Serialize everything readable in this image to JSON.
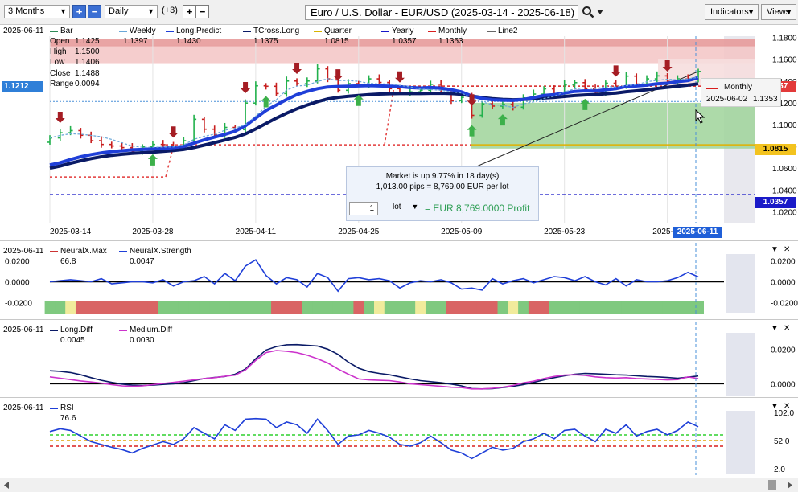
{
  "toolbar": {
    "period": "3 Months",
    "interval": "Daily",
    "overlay_count": "(+3)",
    "title": "Euro / U.S. Dollar - EUR/USD (2025-03-14 - 2025-06-18)",
    "indicators_label": "Indicators",
    "views_label": "Views",
    "plus_glyph": "+",
    "minus_glyph": "−",
    "arrow_glyph": "▼",
    "search_icon": "magnifier",
    "zoom_in_icon": "plus",
    "zoom_out_icon": "minus",
    "chevron_icon": "chevron-down"
  },
  "main_panel": {
    "date": "2025-06-11",
    "legend": [
      {
        "name": "Bar",
        "value": "",
        "color": "#2e8b57"
      },
      {
        "name": "Weekly",
        "value": "1.1397",
        "color": "#6aa7d8"
      },
      {
        "name": "Long.Predict",
        "value": "1.1430",
        "color": "#1f3fd8"
      },
      {
        "name": "TCross.Long",
        "value": "1.1375",
        "color": "#0a1a66"
      },
      {
        "name": "Quarter",
        "value": "1.0815",
        "color": "#d8b400"
      },
      {
        "name": "Yearly",
        "value": "1.0357",
        "color": "#1616c8"
      },
      {
        "name": "Monthly",
        "value": "1.1353",
        "color": "#d81e1e"
      },
      {
        "name": "Line2",
        "value": "",
        "color": "#666666"
      }
    ],
    "ohlc": {
      "open_label": "Open",
      "open": "1.1425",
      "high_label": "High",
      "high": "1.1500",
      "low_label": "Low",
      "low": "1.1406",
      "close_label": "Close",
      "close": "1.1488",
      "range_label": "Range",
      "range": "0.0094"
    },
    "cursor_price": "1.1212",
    "price_labels": {
      "monthly": "1.1357",
      "quarter": "1.0815",
      "yearly": "1.0357"
    },
    "y_ticks": [
      "1.1800",
      "1.1600",
      "1.1400",
      "1.1200",
      "1.1000",
      "1.0800",
      "1.0600",
      "1.0400",
      "1.0200"
    ],
    "x_ticks": [
      "2025-03-14",
      "2025-03-28",
      "2025-04-11",
      "2025-04-25",
      "2025-05-09",
      "2025-05-23",
      "2025-06"
    ],
    "cursor_date": "2025-06-11",
    "popup": {
      "line1": "Market is up 9.77% in 18 day(s)",
      "line2": "1,013.00 pips = 8,769.00 EUR per lot",
      "lot_value": "1",
      "lot_label": "lot",
      "lot_arrow": "▼",
      "profit": "= EUR 8,769.0000 Profit"
    },
    "tooltip": {
      "title": "Monthly",
      "date": "2025-06-02",
      "value": "1.1353",
      "color": "#d81e1e"
    }
  },
  "neural_panel": {
    "date": "2025-06-11",
    "legend": [
      {
        "name": "NeuralX.Max",
        "value": "66.8",
        "color": "#cc3333"
      },
      {
        "name": "NeuralX.Strength",
        "value": "0.0047",
        "color": "#1f3fd8"
      }
    ],
    "y_ticks": [
      "0.0200",
      "0.0000",
      "-0.0200"
    ],
    "close_glyph": "✕",
    "collapse_glyph": "▼"
  },
  "diff_panel": {
    "date": "2025-06-11",
    "legend": [
      {
        "name": "Long.Diff",
        "value": "0.0045",
        "color": "#0a1a66"
      },
      {
        "name": "Medium.Diff",
        "value": "0.0030",
        "color": "#cc33cc"
      }
    ],
    "y_ticks": [
      "0.0200",
      "0.0000"
    ],
    "close_glyph": "✕",
    "collapse_glyph": "▼"
  },
  "rsi_panel": {
    "date": "2025-06-11",
    "legend": [
      {
        "name": "RSI",
        "value": "76.6",
        "color": "#1f3fd8"
      }
    ],
    "y_ticks": [
      "102.0",
      "52.0",
      "2.0"
    ],
    "close_glyph": "✕",
    "collapse_glyph": "▼"
  },
  "chart_data": [
    {
      "type": "ohlc",
      "title": "",
      "x": [
        "2025-03-14",
        "2025-03-17",
        "2025-03-18",
        "2025-03-19",
        "2025-03-20",
        "2025-03-21",
        "2025-03-24",
        "2025-03-25",
        "2025-03-26",
        "2025-03-27",
        "2025-03-28",
        "2025-03-31",
        "2025-04-01",
        "2025-04-02",
        "2025-04-03",
        "2025-04-04",
        "2025-04-07",
        "2025-04-08",
        "2025-04-09",
        "2025-04-10",
        "2025-04-11",
        "2025-04-14",
        "2025-04-15",
        "2025-04-16",
        "2025-04-17",
        "2025-04-18",
        "2025-04-21",
        "2025-04-22",
        "2025-04-23",
        "2025-04-24",
        "2025-04-25",
        "2025-04-28",
        "2025-04-29",
        "2025-04-30",
        "2025-05-01",
        "2025-05-02",
        "2025-05-05",
        "2025-05-06",
        "2025-05-07",
        "2025-05-08",
        "2025-05-09",
        "2025-05-12",
        "2025-05-13",
        "2025-05-14",
        "2025-05-15",
        "2025-05-16",
        "2025-05-19",
        "2025-05-20",
        "2025-05-21",
        "2025-05-22",
        "2025-05-23",
        "2025-05-26",
        "2025-05-27",
        "2025-05-28",
        "2025-05-29",
        "2025-05-30",
        "2025-06-02",
        "2025-06-03",
        "2025-06-04",
        "2025-06-05",
        "2025-06-06",
        "2025-06-09",
        "2025-06-10",
        "2025-06-11"
      ],
      "close": [
        1.0878,
        1.0925,
        1.0945,
        1.0902,
        1.0852,
        1.0818,
        1.0804,
        1.0789,
        1.0754,
        1.0795,
        1.0818,
        1.0816,
        1.079,
        1.0852,
        1.1049,
        1.0958,
        1.0907,
        1.0974,
        1.0954,
        1.1198,
        1.1356,
        1.1352,
        1.1285,
        1.14,
        1.1375,
        1.14,
        1.1512,
        1.142,
        1.1315,
        1.1376,
        1.1365,
        1.142,
        1.1387,
        1.133,
        1.1295,
        1.13,
        1.1315,
        1.137,
        1.1295,
        1.122,
        1.125,
        1.1085,
        1.119,
        1.117,
        1.1185,
        1.116,
        1.1245,
        1.128,
        1.1328,
        1.1285,
        1.1365,
        1.1385,
        1.1327,
        1.1288,
        1.138,
        1.135,
        1.1445,
        1.1372,
        1.142,
        1.1447,
        1.1397,
        1.142,
        1.1418,
        1.1488
      ],
      "series": [
        {
          "name": "Weekly",
          "values": []
        },
        {
          "name": "Long.Predict",
          "values": [
            1.063,
            1.065,
            1.068,
            1.0705,
            1.0725,
            1.074,
            1.0752,
            1.076,
            1.0768,
            1.0772,
            1.0778,
            1.0782,
            1.079,
            1.08,
            1.083,
            1.086,
            1.0885,
            1.091,
            1.094,
            1.099,
            1.106,
            1.113,
            1.118,
            1.123,
            1.1275,
            1.1305,
            1.133,
            1.1345,
            1.135,
            1.1352,
            1.1355,
            1.1358,
            1.1355,
            1.1352,
            1.1348,
            1.134,
            1.1336,
            1.134,
            1.1335,
            1.132,
            1.13,
            1.1262,
            1.124,
            1.1228,
            1.1224,
            1.1222,
            1.123,
            1.1248,
            1.1268,
            1.1275,
            1.129,
            1.1305,
            1.131,
            1.1308,
            1.132,
            1.133,
            1.135,
            1.1355,
            1.1362,
            1.1375,
            1.138,
            1.1395,
            1.1405,
            1.143
          ]
        },
        {
          "name": "TCross.Long",
          "values": [
            1.06,
            1.062,
            1.0645,
            1.0668,
            1.0688,
            1.0705,
            1.0718,
            1.0728,
            1.0736,
            1.0742,
            1.0748,
            1.0755,
            1.0762,
            1.0772,
            1.079,
            1.0812,
            1.0835,
            1.0858,
            1.0882,
            1.0915,
            1.096,
            1.101,
            1.106,
            1.1105,
            1.1145,
            1.118,
            1.121,
            1.1235,
            1.125,
            1.126,
            1.1268,
            1.1275,
            1.128,
            1.1283,
            1.1285,
            1.1285,
            1.1285,
            1.1287,
            1.1288,
            1.1285,
            1.1278,
            1.1262,
            1.1248,
            1.1238,
            1.1232,
            1.1228,
            1.123,
            1.1236,
            1.1244,
            1.125,
            1.1258,
            1.1266,
            1.1272,
            1.1276,
            1.1283,
            1.129,
            1.1302,
            1.131,
            1.132,
            1.1332,
            1.1342,
            1.1352,
            1.1362,
            1.1375
          ]
        }
      ],
      "levels": [
        {
          "name": "Quarter",
          "value": 1.0815
        },
        {
          "name": "Yearly",
          "value": 1.0357
        },
        {
          "name": "Monthly",
          "value": 1.1353
        }
      ],
      "ylim": [
        1.01,
        1.19
      ],
      "x_ticks": [
        "2025-03-14",
        "2025-03-28",
        "2025-04-11",
        "2025-04-25",
        "2025-05-09",
        "2025-05-23",
        "2025-06-06"
      ],
      "down_signals": [
        "2025-03-17",
        "2025-04-01",
        "2025-04-10",
        "2025-04-17",
        "2025-04-23",
        "2025-05-01",
        "2025-05-12",
        "2025-05-30",
        "2025-06-06"
      ],
      "up_signals": [
        "2025-03-28",
        "2025-04-14",
        "2025-04-25",
        "2025-05-12",
        "2025-05-15",
        "2025-05-27"
      ],
      "profit_text": "Market is up 9.77% in 18 day(s)"
    },
    {
      "type": "line",
      "series": [
        {
          "name": "NeuralX.Strength",
          "values": [
            0.0,
            0.001,
            0.002,
            0.001,
            0.0,
            0.003,
            -0.002,
            -0.001,
            0.0,
            0.0,
            -0.001,
            0.002,
            -0.004,
            0.0,
            0.001,
            0.005,
            -0.002,
            0.008,
            0.001,
            0.015,
            0.021,
            0.006,
            -0.002,
            0.004,
            0.002,
            -0.005,
            0.008,
            0.004,
            -0.009,
            0.003,
            0.004,
            0.002,
            0.003,
            0.001,
            -0.006,
            -0.001,
            0.001,
            0.0,
            0.002,
            -0.001,
            -0.007,
            -0.006,
            -0.008,
            0.003,
            -0.002,
            0.001,
            0.003,
            -0.001,
            0.002,
            0.005,
            0.004,
            0.001,
            0.005,
            0.0,
            -0.003,
            0.003,
            -0.004,
            0.002,
            0.0,
            0.0,
            0.001,
            0.004,
            0.009,
            0.0047
          ]
        }
      ],
      "states": [
        "g",
        "g",
        "y",
        "r",
        "r",
        "r",
        "r",
        "r",
        "r",
        "r",
        "r",
        "g",
        "g",
        "g",
        "g",
        "g",
        "g",
        "g",
        "g",
        "g",
        "g",
        "g",
        "r",
        "r",
        "r",
        "g",
        "g",
        "g",
        "g",
        "g",
        "r",
        "g",
        "y",
        "g",
        "g",
        "g",
        "y",
        "g",
        "g",
        "r",
        "r",
        "r",
        "r",
        "r",
        "g",
        "y",
        "g",
        "r",
        "r",
        "g",
        "g",
        "g",
        "g",
        "g",
        "g",
        "g",
        "g",
        "g",
        "g",
        "g",
        "g",
        "g",
        "g",
        "g"
      ],
      "ylim": [
        -0.025,
        0.025
      ]
    },
    {
      "type": "line",
      "series": [
        {
          "name": "Long.Diff",
          "values": [
            0.0075,
            0.0072,
            0.0065,
            0.0052,
            0.0035,
            0.002,
            0.0008,
            -0.0002,
            -0.0008,
            -0.001,
            -0.0008,
            -0.0004,
            0.0,
            0.0006,
            0.0018,
            0.003,
            0.0036,
            0.0042,
            0.0055,
            0.0085,
            0.0145,
            0.0195,
            0.0215,
            0.0225,
            0.0226,
            0.0222,
            0.0218,
            0.02,
            0.017,
            0.0125,
            0.009,
            0.007,
            0.006,
            0.0052,
            0.004,
            0.0028,
            0.0018,
            0.0012,
            0.0006,
            -0.0002,
            -0.0012,
            -0.0028,
            -0.003,
            -0.0028,
            -0.0022,
            -0.0015,
            -0.0005,
            0.0008,
            0.0022,
            0.0035,
            0.0046,
            0.0055,
            0.006,
            0.0058,
            0.0055,
            0.0052,
            0.005,
            0.0046,
            0.0042,
            0.004,
            0.0036,
            0.0032,
            0.0038,
            0.0045
          ]
        },
        {
          "name": "Medium.Diff",
          "values": [
            0.004,
            0.0032,
            0.0024,
            0.0016,
            0.001,
            0.0003,
            -0.0005,
            -0.0012,
            -0.0015,
            -0.0012,
            -0.0005,
            0.0002,
            0.0008,
            0.0015,
            0.0022,
            0.003,
            0.0035,
            0.0043,
            0.005,
            0.008,
            0.0135,
            0.018,
            0.0192,
            0.0188,
            0.018,
            0.0165,
            0.0145,
            0.012,
            0.0085,
            0.0055,
            0.0028,
            0.0022,
            0.002,
            0.0018,
            0.001,
            0.0,
            -0.0005,
            -0.001,
            -0.0015,
            -0.002,
            -0.0022,
            -0.003,
            -0.003,
            -0.0026,
            -0.002,
            -0.001,
            0.0005,
            0.0015,
            0.003,
            0.0042,
            0.005,
            0.0052,
            0.0048,
            0.004,
            0.0035,
            0.0033,
            0.0035,
            0.003,
            0.0028,
            0.0025,
            0.0022,
            0.0024,
            0.004,
            0.003
          ]
        }
      ],
      "ylim": [
        -0.004,
        0.0285
      ]
    },
    {
      "type": "line",
      "series": [
        {
          "name": "RSI",
          "values": [
            68,
            73,
            70,
            60,
            50,
            45,
            40,
            36,
            30,
            38,
            44,
            50,
            45,
            55,
            75,
            65,
            55,
            80,
            70,
            90,
            91,
            90,
            75,
            85,
            80,
            65,
            90,
            70,
            45,
            60,
            62,
            70,
            65,
            58,
            45,
            42,
            48,
            60,
            48,
            35,
            30,
            20,
            30,
            40,
            35,
            38,
            50,
            55,
            65,
            55,
            70,
            72,
            60,
            50,
            72,
            65,
            80,
            60,
            68,
            72,
            62,
            70,
            85,
            76.6
          ]
        }
      ],
      "ylim": [
        2,
        102
      ],
      "levels": [
        {
          "name": "upper",
          "value": 62
        },
        {
          "name": "middle",
          "value": 52
        },
        {
          "name": "lower",
          "value": 42
        }
      ]
    }
  ]
}
